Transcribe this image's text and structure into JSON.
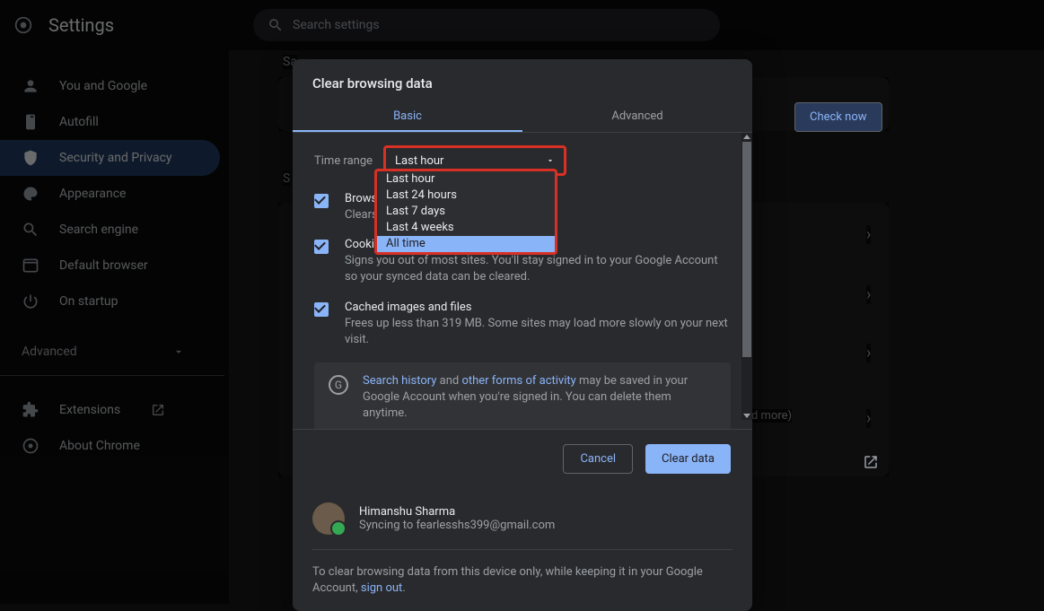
{
  "app_title": "Settings",
  "search_placeholder": "Search settings",
  "sidebar": {
    "items": [
      {
        "label": "You and Google"
      },
      {
        "label": "Autofill"
      },
      {
        "label": "Security and Privacy"
      },
      {
        "label": "Appearance"
      },
      {
        "label": "Search engine"
      },
      {
        "label": "Default browser"
      },
      {
        "label": "On startup"
      }
    ],
    "advanced": "Advanced",
    "extensions": "Extensions",
    "about": "About Chrome"
  },
  "background": {
    "section1_prefix": "Sa",
    "section2_prefix": "S",
    "check_now": "Check now",
    "more_suffix": "d more)"
  },
  "dialog": {
    "title": "Clear browsing data",
    "tabs": {
      "basic": "Basic",
      "advanced": "Advanced"
    },
    "time_label": "Time range",
    "time_selected": "Last hour",
    "time_options": [
      "Last hour",
      "Last 24 hours",
      "Last 7 days",
      "Last 4 weeks",
      "All time"
    ],
    "items": [
      {
        "title": "Browsi",
        "desc": "Clears"
      },
      {
        "title": "Cookies and other site data",
        "desc": "Signs you out of most sites. You'll stay signed in to your Google Account so your synced data can be cleared."
      },
      {
        "title": "Cached images and files",
        "desc": "Frees up less than 319 MB. Some sites may load more slowly on your next visit."
      }
    ],
    "notice": {
      "link1": "Search history",
      "mid": " and ",
      "link2": "other forms of activity",
      "rest": " may be saved in your Google Account when you're signed in. You can delete them anytime."
    },
    "cancel": "Cancel",
    "clear": "Clear data",
    "account": {
      "name": "Himanshu Sharma",
      "sync": "Syncing to fearlesshs399@gmail.com"
    },
    "footnote_a": "To clear browsing data from this device only, while keeping it in your Google Account, ",
    "footnote_link": "sign out",
    "footnote_b": "."
  }
}
